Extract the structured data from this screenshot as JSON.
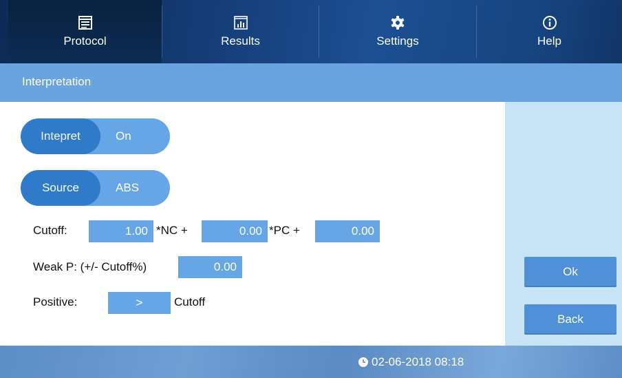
{
  "nav": {
    "tabs": [
      {
        "label": "Protocol",
        "icon": "screen-icon",
        "active": true
      },
      {
        "label": "Results",
        "icon": "bar-chart-icon",
        "active": false
      },
      {
        "label": "Settings",
        "icon": "gear-icon",
        "active": false
      },
      {
        "label": "Help",
        "icon": "info-icon",
        "active": false
      }
    ]
  },
  "header": {
    "title": "Interpretation"
  },
  "toggles": {
    "interpret": {
      "label": "Intepret",
      "value": "On"
    },
    "source": {
      "label": "Source",
      "value": "ABS"
    }
  },
  "form": {
    "cutoff_label": "Cutoff:",
    "cutoff_value": "1.00",
    "nc_label": "*NC +",
    "nc_value": "0.00",
    "pc_label": "*PC +",
    "pc_value": "0.00",
    "weakp_label": "Weak P: (+/- Cutoff%)",
    "weakp_value": "0.00",
    "positive_label": "Positive:",
    "positive_operator": ">",
    "positive_suffix": "Cutoff"
  },
  "buttons": {
    "ok": "Ok",
    "back": "Back"
  },
  "footer": {
    "datetime": "02-06-2018 08:18"
  },
  "colors": {
    "accent": "#2f7ac9",
    "field": "#67a6e6",
    "header": "#6aa3e0",
    "panel": "#c7e3f6"
  }
}
